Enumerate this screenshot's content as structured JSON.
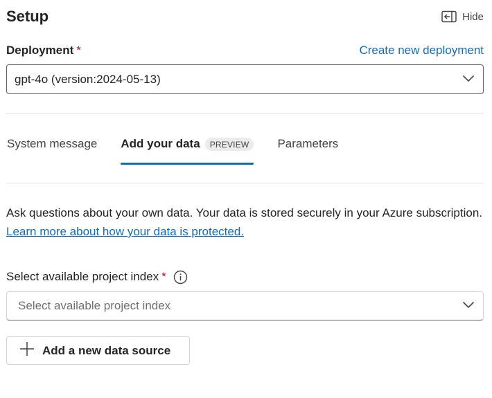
{
  "header": {
    "title": "Setup",
    "hide_label": "Hide"
  },
  "deployment": {
    "label": "Deployment",
    "required_mark": "*",
    "create_link": "Create new deployment",
    "selected_value": "gpt-4o (version:2024-05-13)"
  },
  "tabs": [
    {
      "label": "System message",
      "active": false
    },
    {
      "label": "Add your data",
      "badge": "PREVIEW",
      "active": true
    },
    {
      "label": "Parameters",
      "active": false
    }
  ],
  "description": {
    "text": "Ask questions about your own data. Your data is stored securely in your Azure subscription. ",
    "link": "Learn more about how your data is protected."
  },
  "project_index": {
    "label": "Select available project index",
    "required_mark": "*",
    "placeholder": "Select available project index"
  },
  "add_source_button": {
    "label": "Add a new data source"
  },
  "colors": {
    "accent": "#0f6cbd",
    "required": "#c50f1f",
    "text": "#242424"
  },
  "icons": [
    "panel-collapse-icon",
    "chevron-down-icon",
    "info-icon",
    "plus-icon"
  ]
}
